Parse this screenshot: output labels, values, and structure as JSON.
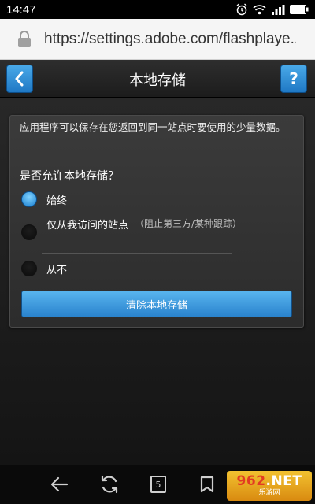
{
  "status_bar": {
    "time": "14:47"
  },
  "browser": {
    "url": "https://settings.adobe.com/flashplaye.."
  },
  "header": {
    "title": "本地存储",
    "back_icon": "chevron-left-icon",
    "help_label": "?"
  },
  "panel": {
    "description": "应用程序可以保存在您返回到同一站点时要使用的少量数据。",
    "question": "是否允许本地存储？",
    "options": [
      {
        "label": "始终",
        "selected": true
      },
      {
        "label": "仅从我访问的站点",
        "note": "（阻止第三方/某种跟踪）",
        "selected": false
      },
      {
        "label": "从不",
        "selected": false
      }
    ],
    "clear_button": "清除本地存储"
  },
  "bottom_nav": {
    "tabs_count": "5"
  },
  "watermark": {
    "brand_num": "962",
    "brand_suffix": ".NET",
    "brand_sub": "乐游网"
  },
  "colors": {
    "accent": "#2a83cd",
    "selected_radio": "#1a7fd0",
    "watermark": "#e8a51c"
  }
}
